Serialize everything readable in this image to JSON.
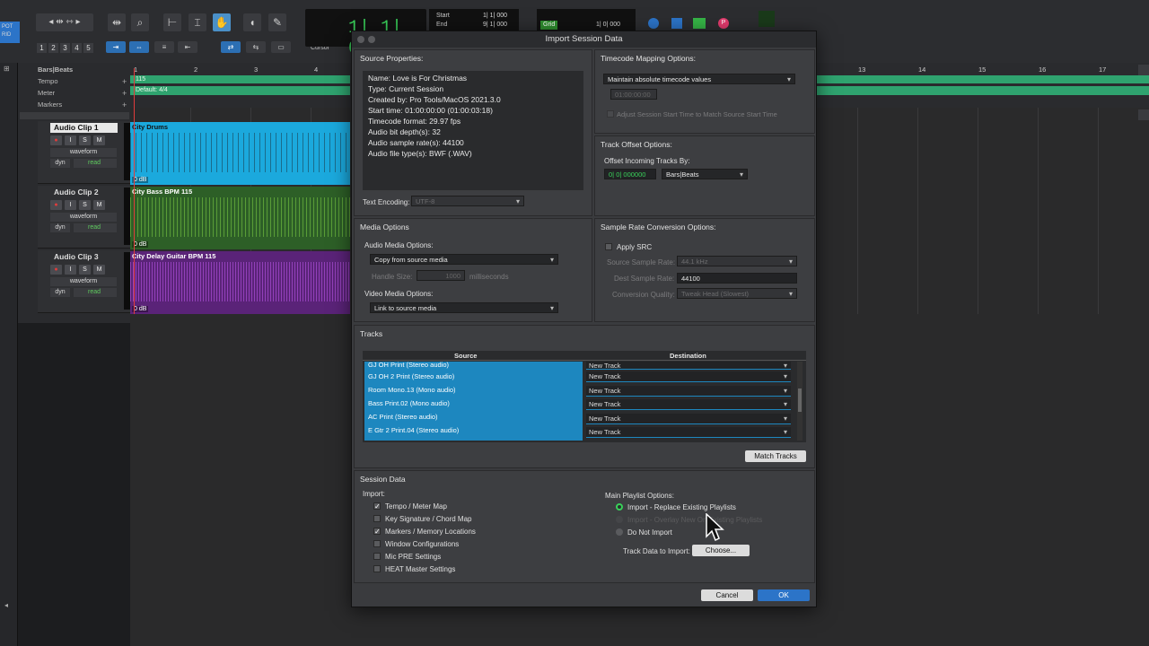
{
  "toolbar": {
    "numbers": [
      "1",
      "2",
      "3",
      "4",
      "5"
    ],
    "counter_main": "1| 1| 000",
    "start_label": "Start",
    "end_label": "End",
    "start_value": "1| 1| 000",
    "end_value": "9| 1| 000",
    "cursor_label": "Cursor",
    "grid_label": "Grid",
    "grid_value": "1| 0| 000",
    "pot_label": "POT",
    "grid_tag": "RID"
  },
  "ruler": {
    "bars_beats_label": "Bars|Beats",
    "tempo_label": "Tempo",
    "meter_label": "Meter",
    "markers_label": "Markers",
    "tempo_value": "115",
    "meter_value": "Default: 4/4",
    "bar_numbers": [
      "1",
      "2",
      "3",
      "4",
      "13",
      "14",
      "15",
      "16",
      "17"
    ]
  },
  "tracks": [
    {
      "name": "Audio Clip 1",
      "view": "waveform",
      "automation": "read",
      "dyn": "dyn",
      "clip_title": "City Drums",
      "clip_gain": "0 dB",
      "color": "#1ba9dd",
      "wave": "#1a3a4a"
    },
    {
      "name": "Audio Clip 2",
      "view": "waveform",
      "automation": "read",
      "dyn": "dyn",
      "clip_title": "City Bass BPM 115",
      "clip_gain": "0 dB",
      "color": "#2d5f27",
      "wave": "#8fe84a"
    },
    {
      "name": "Audio Clip 3",
      "view": "waveform",
      "automation": "read",
      "dyn": "dyn",
      "clip_title": "City Delay Guitar BPM 115",
      "clip_gain": "0 dB",
      "color": "#5a2378",
      "wave": "#c158f0"
    }
  ],
  "track_buttons": {
    "solo": "S",
    "mute": "M",
    "input": "I"
  },
  "dialog": {
    "title": "Import Session Data",
    "source_properties": {
      "title": "Source Properties:",
      "lines": [
        "Name: Love is For Christmas",
        "Type: Current Session",
        "Created by: Pro Tools/MacOS 2021.3.0",
        "Start time: 01:00:00:00 (01:00:03:18)",
        "Timecode format: 29.97 fps",
        "Audio bit depth(s): 32",
        "Audio sample rate(s): 44100",
        "Audio file type(s): BWF (.WAV)"
      ],
      "text_encoding_label": "Text Encoding:",
      "text_encoding_value": "UTF-8"
    },
    "timecode_mapping": {
      "title": "Timecode Mapping Options:",
      "selected": "Maintain absolute timecode values",
      "field_value": "01:00:00:00",
      "adjust_label": "Adjust Session Start Time to Match Source Start Time"
    },
    "track_offset": {
      "title": "Track Offset Options:",
      "offset_label": "Offset Incoming Tracks By:",
      "offset_value": "0| 0| 000000",
      "unit": "Bars|Beats"
    },
    "media_options": {
      "title": "Media Options",
      "audio_label": "Audio Media Options:",
      "audio_value": "Copy from source media",
      "handle_label": "Handle Size:",
      "handle_value": "1000",
      "handle_unit": "milliseconds",
      "video_label": "Video Media Options:",
      "video_value": "Link to source media"
    },
    "sample_rate": {
      "title": "Sample Rate Conversion Options:",
      "apply_label": "Apply SRC",
      "source_label": "Source Sample Rate:",
      "source_value": "44.1 kHz",
      "dest_label": "Dest Sample Rate:",
      "dest_value": "44100",
      "quality_label": "Conversion Quality:",
      "quality_value": "Tweak Head (Slowest)"
    },
    "tracks": {
      "title": "Tracks",
      "source_header": "Source",
      "destination_header": "Destination",
      "rows": [
        {
          "source": "GJ OH Print (Stereo audio)",
          "dest": "New Track"
        },
        {
          "source": "GJ OH 2 Print (Stereo audio)",
          "dest": "New Track"
        },
        {
          "source": "Room Mono.13 (Mono audio)",
          "dest": "New Track"
        },
        {
          "source": "Bass Print.02 (Mono audio)",
          "dest": "New Track"
        },
        {
          "source": "AC Print (Stereo audio)",
          "dest": "New Track"
        },
        {
          "source": "E Gtr 2 Print.04 (Stereo audio)",
          "dest": "New Track"
        }
      ],
      "match_button": "Match Tracks"
    },
    "session_data": {
      "title": "Session Data",
      "import_label": "Import:",
      "checkboxes": [
        {
          "label": "Tempo / Meter Map",
          "checked": true
        },
        {
          "label": "Key Signature / Chord Map",
          "checked": false
        },
        {
          "label": "Markers / Memory Locations",
          "checked": true
        },
        {
          "label": "Window Configurations",
          "checked": false
        },
        {
          "label": "Mic PRE Settings",
          "checked": false
        },
        {
          "label": "HEAT Master Settings",
          "checked": false
        }
      ],
      "playlist_label": "Main Playlist Options:",
      "playlist_options": [
        {
          "label": "Import - Replace Existing Playlists",
          "selected": true,
          "enabled": true
        },
        {
          "label": "Import - Overlay New On Existing Playlists",
          "selected": false,
          "enabled": false
        },
        {
          "label": "Do Not Import",
          "selected": false,
          "enabled": true
        }
      ],
      "track_data_label": "Track Data to Import:",
      "choose_button": "Choose..."
    },
    "cancel_button": "Cancel",
    "ok_button": "OK"
  }
}
